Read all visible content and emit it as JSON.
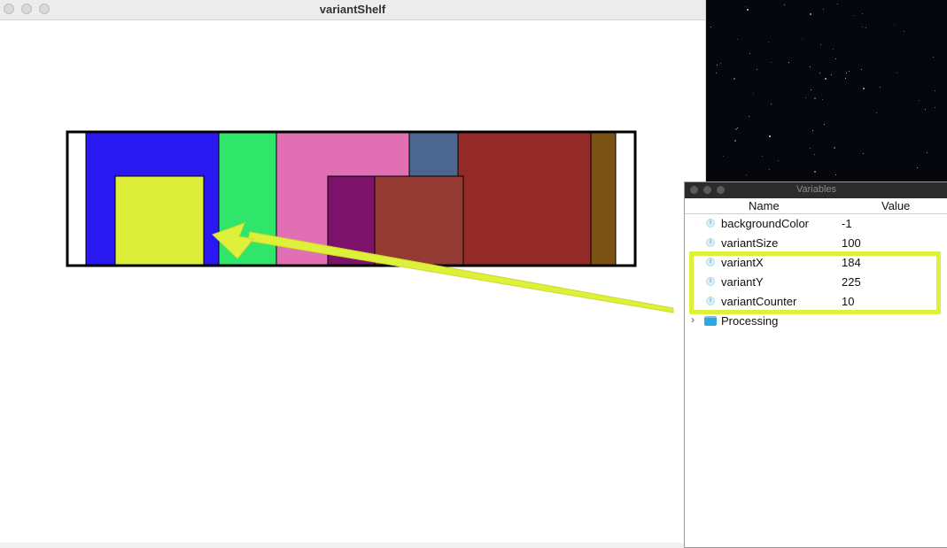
{
  "sketch_window": {
    "title": "variantShelf"
  },
  "shelf": {
    "colors": {
      "outline": "#000000",
      "blue": "#2a18f2",
      "green": "#2fe66a",
      "pink": "#e06fb3",
      "slate": "#4b678f",
      "dark_red": "#932a27",
      "brown": "#7a5214",
      "yellow": "#dcee3a",
      "purple": "#7c126a",
      "rust": "#943a32"
    }
  },
  "variables_window": {
    "title": "Variables",
    "columns": {
      "name": "Name",
      "value": "Value"
    },
    "rows": [
      {
        "name": "backgroundColor",
        "value": "-1",
        "icon": "int-variable-icon"
      },
      {
        "name": "variantSize",
        "value": "100",
        "icon": "int-variable-icon"
      },
      {
        "name": "variantX",
        "value": "184",
        "icon": "int-variable-icon"
      },
      {
        "name": "variantY",
        "value": "225",
        "icon": "int-variable-icon"
      },
      {
        "name": "variantCounter",
        "value": "10",
        "icon": "int-variable-icon"
      }
    ],
    "folder": {
      "label": "Processing",
      "icon": "folder-icon",
      "expanded": false
    }
  },
  "annotation": {
    "highlight_color": "#dff03a",
    "highlighted_rows": [
      "variantX",
      "variantY",
      "variantCounter"
    ]
  }
}
